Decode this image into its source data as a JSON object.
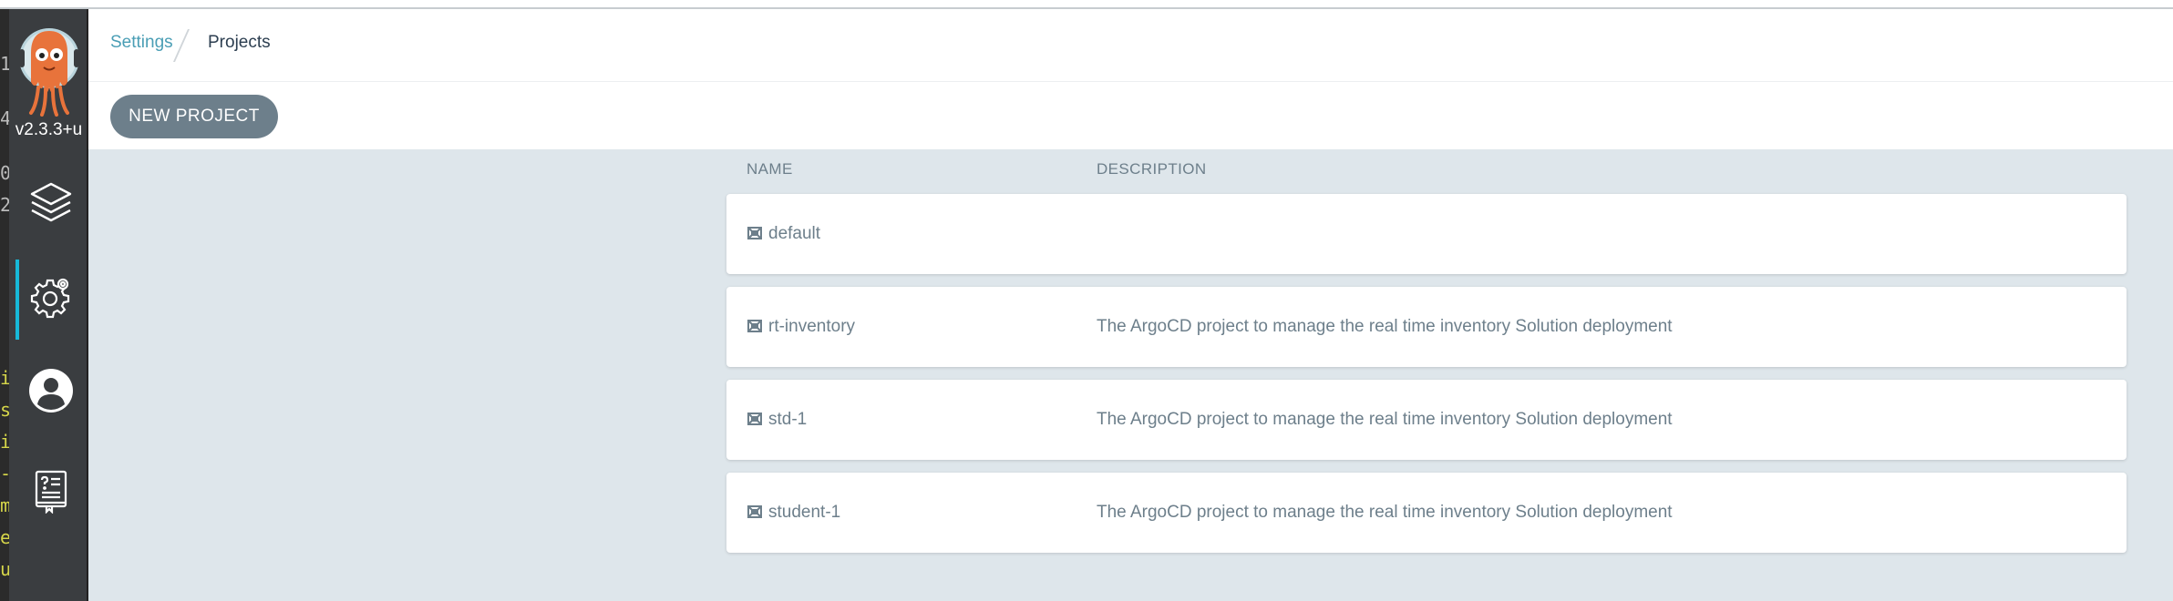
{
  "app": {
    "version": "v2.3.3+u"
  },
  "sidebar": {
    "items": [
      {
        "name": "applications",
        "icon": "layers-icon"
      },
      {
        "name": "settings",
        "icon": "gear-icon",
        "active": true
      },
      {
        "name": "user-info",
        "icon": "user-circle-icon"
      },
      {
        "name": "documentation",
        "icon": "book-icon"
      }
    ]
  },
  "breadcrumb": {
    "parent": "Settings",
    "current": "Projects"
  },
  "toolbar": {
    "new_project_label": "NEW PROJECT"
  },
  "table": {
    "columns": [
      "NAME",
      "DESCRIPTION"
    ],
    "rows": [
      {
        "name": "default",
        "description": ""
      },
      {
        "name": "rt-inventory",
        "description": "The ArgoCD project to manage the real time inventory Solution deployment"
      },
      {
        "name": "std-1",
        "description": "The ArgoCD project to manage the real time inventory Solution deployment"
      },
      {
        "name": "student-1",
        "description": "The ArgoCD project to manage the real time inventory Solution deployment"
      }
    ]
  },
  "colors": {
    "sidebar_bg": "#3a3d40",
    "accent": "#17b9d9",
    "link": "#4a9eb5",
    "button": "#6d7f8b",
    "page_bg": "#dee6eb"
  }
}
